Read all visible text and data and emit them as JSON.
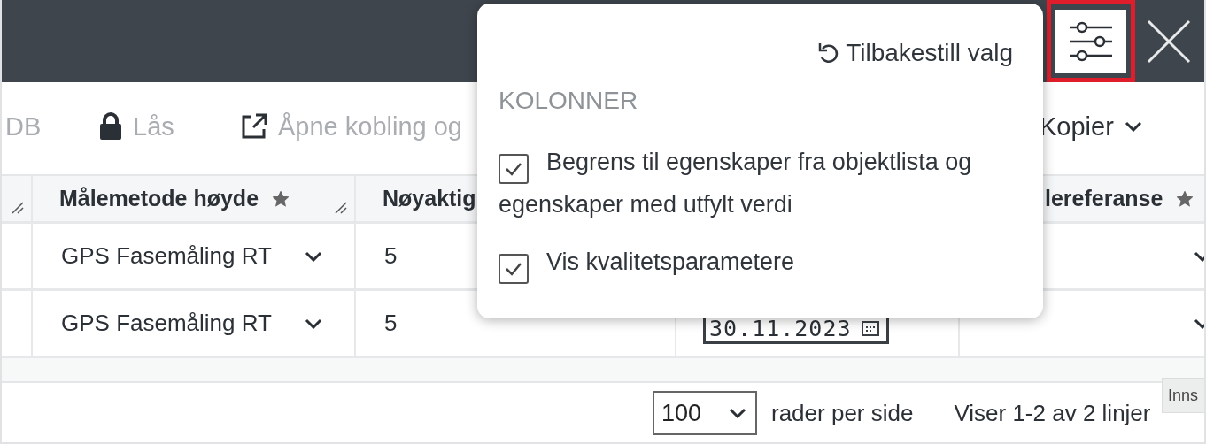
{
  "top_bar": {
    "settings_button": {
      "highlighted": true
    }
  },
  "toolbar": [
    {
      "label": "DB",
      "kind": "plain",
      "disabled": true
    },
    {
      "label": "Lås",
      "kind": "lock",
      "disabled": true
    },
    {
      "label": "Åpne kobling og",
      "kind": "external",
      "disabled": true
    },
    {
      "label": "Kopier",
      "kind": "menu",
      "disabled": false
    }
  ],
  "table": {
    "columns": [
      {
        "kind": "stub"
      },
      {
        "kind": "text",
        "label": "Målemetode høyde",
        "starred": true
      },
      {
        "kind": "text",
        "label": "Nøyaktig"
      },
      {
        "kind": "hidden"
      },
      {
        "kind": "text",
        "label": "lereferanse",
        "starred": true
      }
    ],
    "rows": [
      {
        "cells": [
          {
            "kind": "empty"
          },
          {
            "kind": "select",
            "value": "GPS Fasemåling RT"
          },
          {
            "kind": "text",
            "value": "5"
          },
          {
            "kind": "empty"
          },
          {
            "kind": "select"
          }
        ]
      },
      {
        "cells": [
          {
            "kind": "empty"
          },
          {
            "kind": "select",
            "value": "GPS Fasemåling RT"
          },
          {
            "kind": "text",
            "value": "5"
          },
          {
            "kind": "date",
            "value": "30.11.2023"
          },
          {
            "kind": "select"
          }
        ]
      }
    ]
  },
  "footer": {
    "page_size": "100",
    "page_size_label": "rader per side",
    "range": "Viser 1-2 av 2 linjer"
  },
  "tooltip": {
    "text": "Inns"
  },
  "popover": {
    "reset_label": "Tilbakestill valg",
    "section_title": "KOLONNER",
    "options": [
      {
        "label": "Begrens til egenskaper fra objektlista og egenskaper med utfylt verdi",
        "checked": true
      },
      {
        "label": "Vis kvalitetsparametere",
        "checked": true
      }
    ]
  }
}
